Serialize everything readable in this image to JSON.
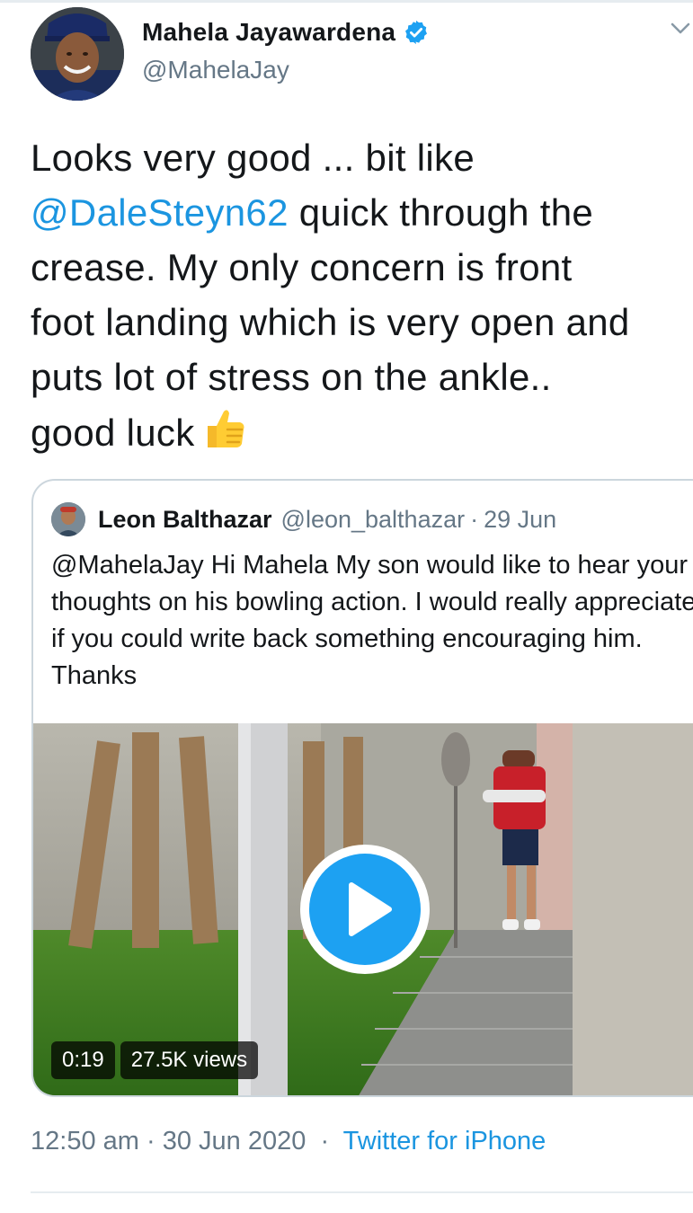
{
  "tweet": {
    "author_name": "Mahela Jayawardena",
    "author_handle": "@MahelaJay",
    "text_lines": [
      "Looks very good ... bit like",
      "quick through the",
      "crease. My only concern is front",
      "foot landing which is very open and",
      "puts lot of stress on the ankle..",
      "good luck"
    ],
    "mention": "@DaleSteyn62",
    "emoji": "thumbs-up",
    "time": "12:50 am",
    "date": "30 Jun 2020",
    "source": "Twitter for iPhone",
    "dot": "·"
  },
  "quoted": {
    "author_name": "Leon Balthazar",
    "author_handle": "@leon_balthazar",
    "dot": "·",
    "date": "29 Jun",
    "text": "@MahelaJay Hi Mahela My son would like to hear your thoughts on his  bowling action. I would really appreciate if you could write back something encouraging him. Thanks",
    "video": {
      "duration": "0:19",
      "views": "27.5K views"
    }
  },
  "colors": {
    "link": "#1b95e0",
    "secondary": "#657786",
    "border": "#ccd6dd",
    "verified": "#1da1f2"
  }
}
